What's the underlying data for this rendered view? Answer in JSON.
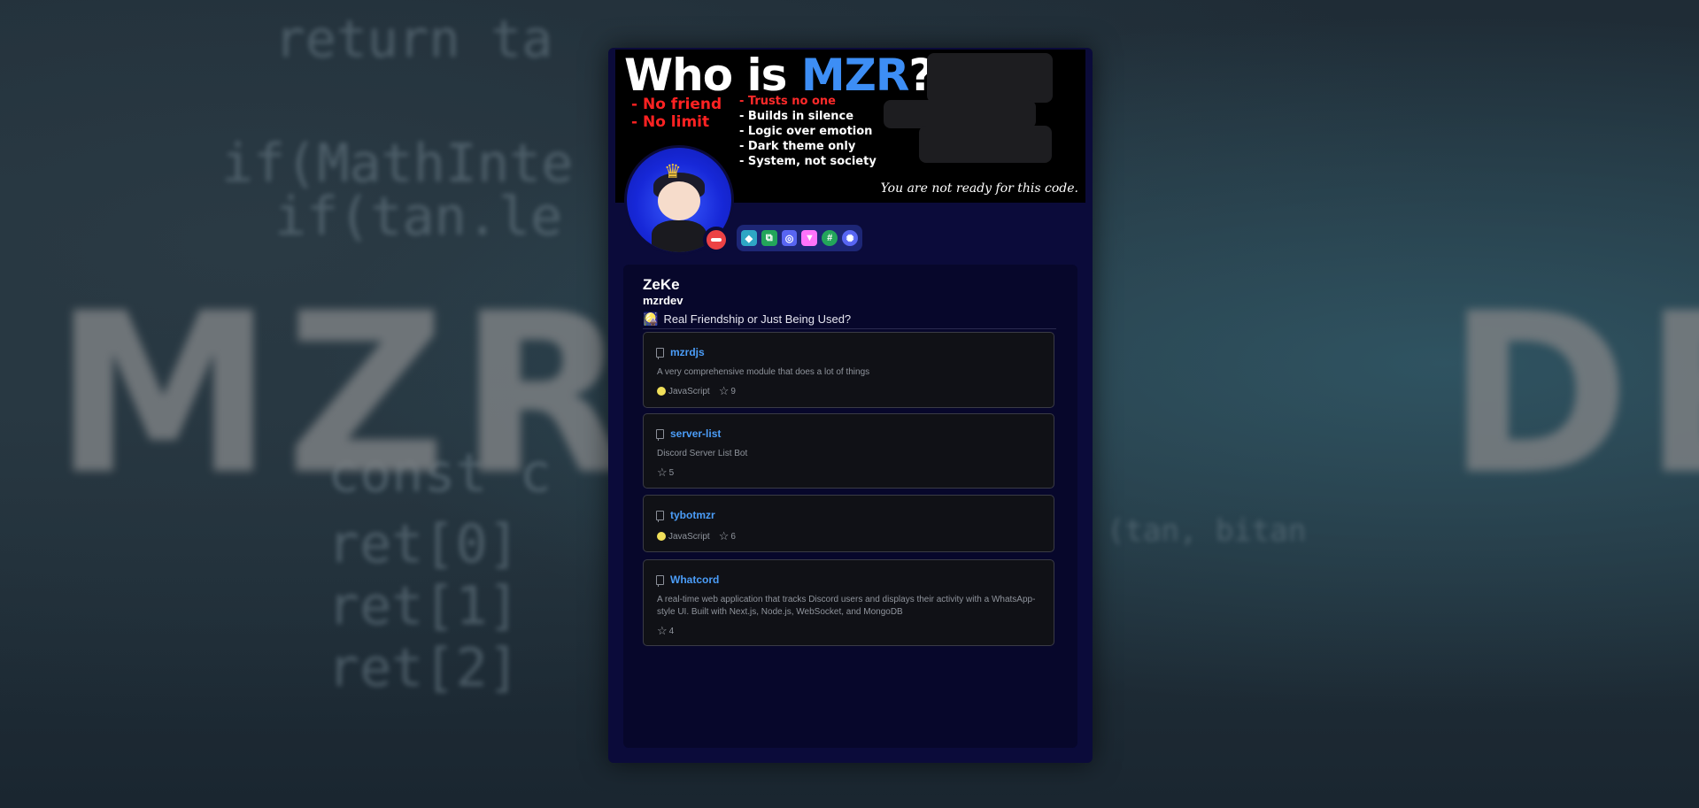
{
  "banner": {
    "title_prefix": "Who is ",
    "title_accent": "MZR",
    "title_suffix": "?",
    "red_lines": [
      "- No friend",
      "- No limit"
    ],
    "traits": [
      "- Trusts no one",
      "- Builds in silence",
      "- Logic over emotion",
      "- Dark theme only",
      "- System, not society"
    ],
    "tagline": "You are not ready for this code."
  },
  "badges": [
    "active-developer-icon",
    "bot-developer-icon",
    "hypesquad-icon",
    "nitro-icon",
    "hashtag-icon",
    "quest-icon"
  ],
  "profile": {
    "display_name": "ZeKe",
    "username": "mzrdev",
    "status_emoji": "🎑",
    "status_text": "Real Friendship or Just Being Used?"
  },
  "repos": [
    {
      "name": "mzrdjs",
      "description": "A very comprehensive module that does a lot of things",
      "language": "JavaScript",
      "stars": "9"
    },
    {
      "name": "server-list",
      "description": "Discord Server List Bot",
      "language": "",
      "stars": "5"
    },
    {
      "name": "tybotmzr",
      "description": "",
      "language": "JavaScript",
      "stars": "6"
    },
    {
      "name": "Whatcord",
      "description": "A real-time web application that tracks Discord users and displays their activity with a WhatsApp-style UI. Built with Next.js, Node.js, WebSocket, and MongoDB",
      "language": "",
      "stars": "4"
    }
  ],
  "colors": {
    "card": "#0b0b3a",
    "panel": "#07072b",
    "link": "#4b9df8",
    "javascript": "#f1e05a",
    "dnd": "#ed4245"
  }
}
